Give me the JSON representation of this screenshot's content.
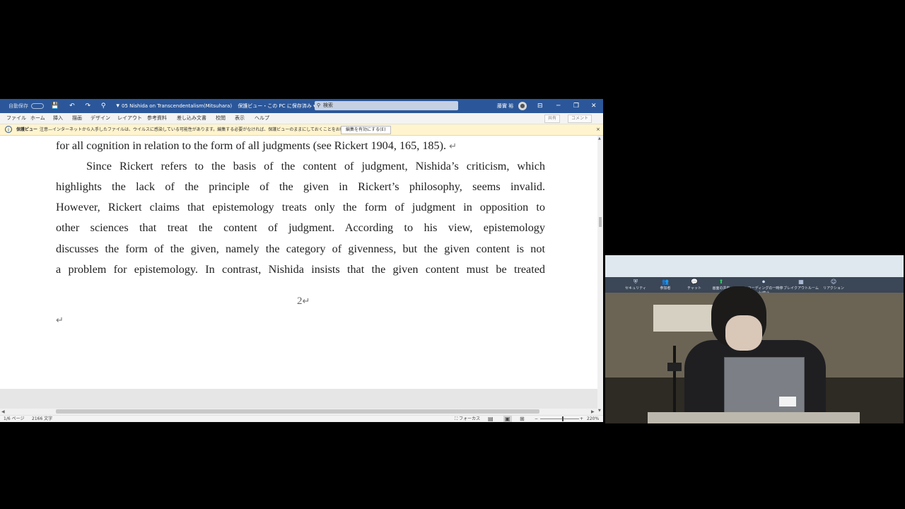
{
  "titlebar": {
    "autosave": "自動保存",
    "autosave_state": "オフ",
    "qat": "💾 ↶ ↷ ⚲ ▾",
    "doc_title": "05 Nishida on Transcendentalism(Mitsuhara)",
    "doc_status": "保護ビュー・この PC に保存済み ▾",
    "search_placeholder": "検索",
    "user_name": "藤實 裕",
    "min": "─",
    "max": "❐",
    "close": "✕",
    "ribbon_opt": "⊟"
  },
  "menu": {
    "tabs": [
      "ファイル",
      "ホーム",
      "挿入",
      "描画",
      "デザイン",
      "レイアウト",
      "参考資料",
      "差し込み文書",
      "校閲",
      "表示",
      "ヘルプ"
    ],
    "share": "共有",
    "comments": "コメント"
  },
  "protected_view": {
    "title": "保護ビュー",
    "message": "注意—インターネットから入手したファイルは、ウイルスに感染している可能性があります。編集する必要がなければ、保護ビューのままにしておくことをお勧めします。",
    "enable_button": "編集を有効にする(E)",
    "close": "×"
  },
  "document": {
    "line0": "for all cognition in relation to the form of all judgments (see Rickert 1904, 165, 185).",
    "para": [
      "Since Rickert refers to the basis of the content of judgment, Nishida’s criticism, which",
      "highlights the lack of the principle of the given in Rickert’s philosophy, seems invalid.",
      "However, Rickert claims that epistemology treats only the form of judgment in opposition to",
      "other sciences that treat the content of judgment. According to his view, epistemology",
      "discusses the form of the given, namely the category of givenness, but the given content is not",
      "a problem for epistemology. In contrast, Nishida insists that the given content must be treated"
    ],
    "return_mark": "↵",
    "page_number": "2"
  },
  "statusbar": {
    "page": "1/6 ページ",
    "words": "2166 文字",
    "focus": "フォーカス",
    "zoom": "220%"
  },
  "video": {
    "toolbar": [
      {
        "glyph": "⛨",
        "label": "セキュリティ"
      },
      {
        "glyph": "👥",
        "label": "参加者"
      },
      {
        "glyph": "💬",
        "label": "チャット"
      },
      {
        "glyph": "⬆",
        "label": "画面の共有"
      },
      {
        "glyph": "⏺",
        "label": "レコーディングの一時停止/停止"
      },
      {
        "glyph": "▦",
        "label": "ブレイクアウトルーム"
      },
      {
        "glyph": "☺",
        "label": "リアクション"
      }
    ]
  },
  "colors": {
    "word_blue": "#2b579a",
    "protected_bar": "#fff4ce"
  }
}
